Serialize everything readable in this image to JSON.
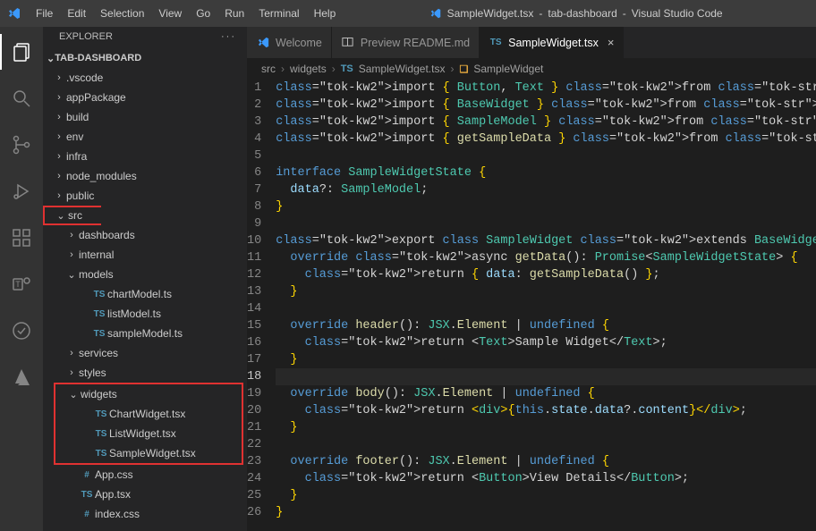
{
  "titlebar": {
    "menus": [
      "File",
      "Edit",
      "Selection",
      "View",
      "Go",
      "Run",
      "Terminal",
      "Help"
    ],
    "center_file": "SampleWidget.tsx",
    "center_project": "tab-dashboard",
    "center_app": "Visual Studio Code"
  },
  "sidebar": {
    "header": "EXPLORER",
    "project": "TAB-DASHBOARD",
    "tree": [
      {
        "d": 1,
        "icon": "chev",
        "open": false,
        "label": ".vscode"
      },
      {
        "d": 1,
        "icon": "chev",
        "open": false,
        "label": "appPackage"
      },
      {
        "d": 1,
        "icon": "chev",
        "open": false,
        "label": "build"
      },
      {
        "d": 1,
        "icon": "chev",
        "open": false,
        "label": "env"
      },
      {
        "d": 1,
        "icon": "chev",
        "open": false,
        "label": "infra"
      },
      {
        "d": 1,
        "icon": "chev",
        "open": false,
        "label": "node_modules"
      },
      {
        "d": 1,
        "icon": "chev",
        "open": false,
        "label": "public"
      },
      {
        "d": 1,
        "icon": "chev",
        "open": true,
        "label": "src",
        "hl": "src"
      },
      {
        "d": 2,
        "icon": "chev",
        "open": false,
        "label": "dashboards"
      },
      {
        "d": 2,
        "icon": "chev",
        "open": false,
        "label": "internal"
      },
      {
        "d": 2,
        "icon": "chev",
        "open": true,
        "label": "models"
      },
      {
        "d": 3,
        "icon": "ts",
        "label": "chartModel.ts"
      },
      {
        "d": 3,
        "icon": "ts",
        "label": "listModel.ts"
      },
      {
        "d": 3,
        "icon": "ts",
        "label": "sampleModel.ts"
      },
      {
        "d": 2,
        "icon": "chev",
        "open": false,
        "label": "services"
      },
      {
        "d": 2,
        "icon": "chev",
        "open": false,
        "label": "styles"
      },
      {
        "d": 2,
        "icon": "chev",
        "open": true,
        "label": "widgets",
        "hl": "widgets"
      },
      {
        "d": 3,
        "icon": "ts",
        "label": "ChartWidget.tsx",
        "hl": "widgets"
      },
      {
        "d": 3,
        "icon": "ts",
        "label": "ListWidget.tsx",
        "hl": "widgets"
      },
      {
        "d": 3,
        "icon": "ts",
        "label": "SampleWidget.tsx",
        "hl": "widgets"
      },
      {
        "d": 2,
        "icon": "hash",
        "label": "App.css"
      },
      {
        "d": 2,
        "icon": "ts",
        "label": "App.tsx"
      },
      {
        "d": 2,
        "icon": "hash",
        "label": "index.css"
      }
    ]
  },
  "tabs": [
    {
      "icon": "vscode",
      "label": "Welcome",
      "active": false,
      "close": false
    },
    {
      "icon": "preview",
      "label": "Preview README.md",
      "active": false,
      "close": false
    },
    {
      "icon": "ts",
      "label": "SampleWidget.tsx",
      "active": true,
      "close": true
    }
  ],
  "breadcrumb": {
    "parts": [
      "src",
      "widgets"
    ],
    "file": "SampleWidget.tsx",
    "symbol": "SampleWidget"
  },
  "code": {
    "current_line": 18,
    "lines": [
      "import { Button, Text } from \"@fluentui/react-components\";",
      "import { BaseWidget } from \"@microsoft/teamsfx-react\";",
      "import { SampleModel } from \"../models/sampleModel\";",
      "import { getSampleData } from \"../services/sampleService\";",
      "",
      "interface SampleWidgetState {",
      "  data?: SampleModel;",
      "}",
      "",
      "export class SampleWidget extends BaseWidget<any, SampleWidgetState> {",
      "  override async getData(): Promise<SampleWidgetState> {",
      "    return { data: getSampleData() };",
      "  }",
      "",
      "  override header(): JSX.Element | undefined {",
      "    return <Text>Sample Widget</Text>;",
      "  }",
      "",
      "  override body(): JSX.Element | undefined {",
      "    return <div>{this.state.data?.content}</div>;",
      "  }",
      "",
      "  override footer(): JSX.Element | undefined {",
      "    return <Button>View Details</Button>;",
      "  }",
      "}"
    ]
  }
}
